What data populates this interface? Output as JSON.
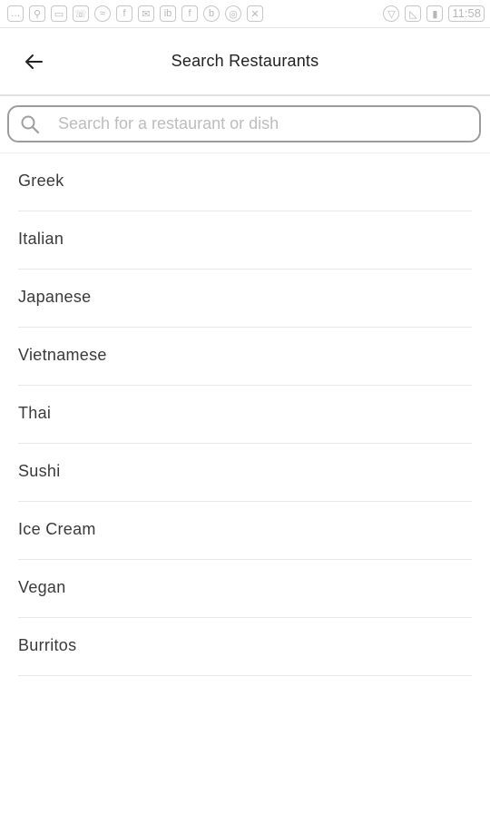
{
  "status_bar": {
    "time": "11:58",
    "icons": [
      "chat-icon",
      "search-icon",
      "message-icon",
      "phone-icon",
      "wifi-icon",
      "facebook-icon",
      "mail-icon",
      "ib-icon",
      "facebook-icon",
      "b-icon",
      "sync-icon",
      "signal-off-icon",
      "wifi-signal-icon",
      "no-sim-icon",
      "battery-icon"
    ]
  },
  "header": {
    "back_icon": "arrow-left-icon",
    "title": "Search Restaurants"
  },
  "search": {
    "icon": "search-icon",
    "placeholder": "Search for a restaurant or dish",
    "value": ""
  },
  "categories": [
    {
      "label": "Greek"
    },
    {
      "label": "Italian"
    },
    {
      "label": "Japanese"
    },
    {
      "label": "Vietnamese"
    },
    {
      "label": "Thai"
    },
    {
      "label": "Sushi"
    },
    {
      "label": "Ice Cream"
    },
    {
      "label": "Vegan"
    },
    {
      "label": "Burritos"
    }
  ]
}
